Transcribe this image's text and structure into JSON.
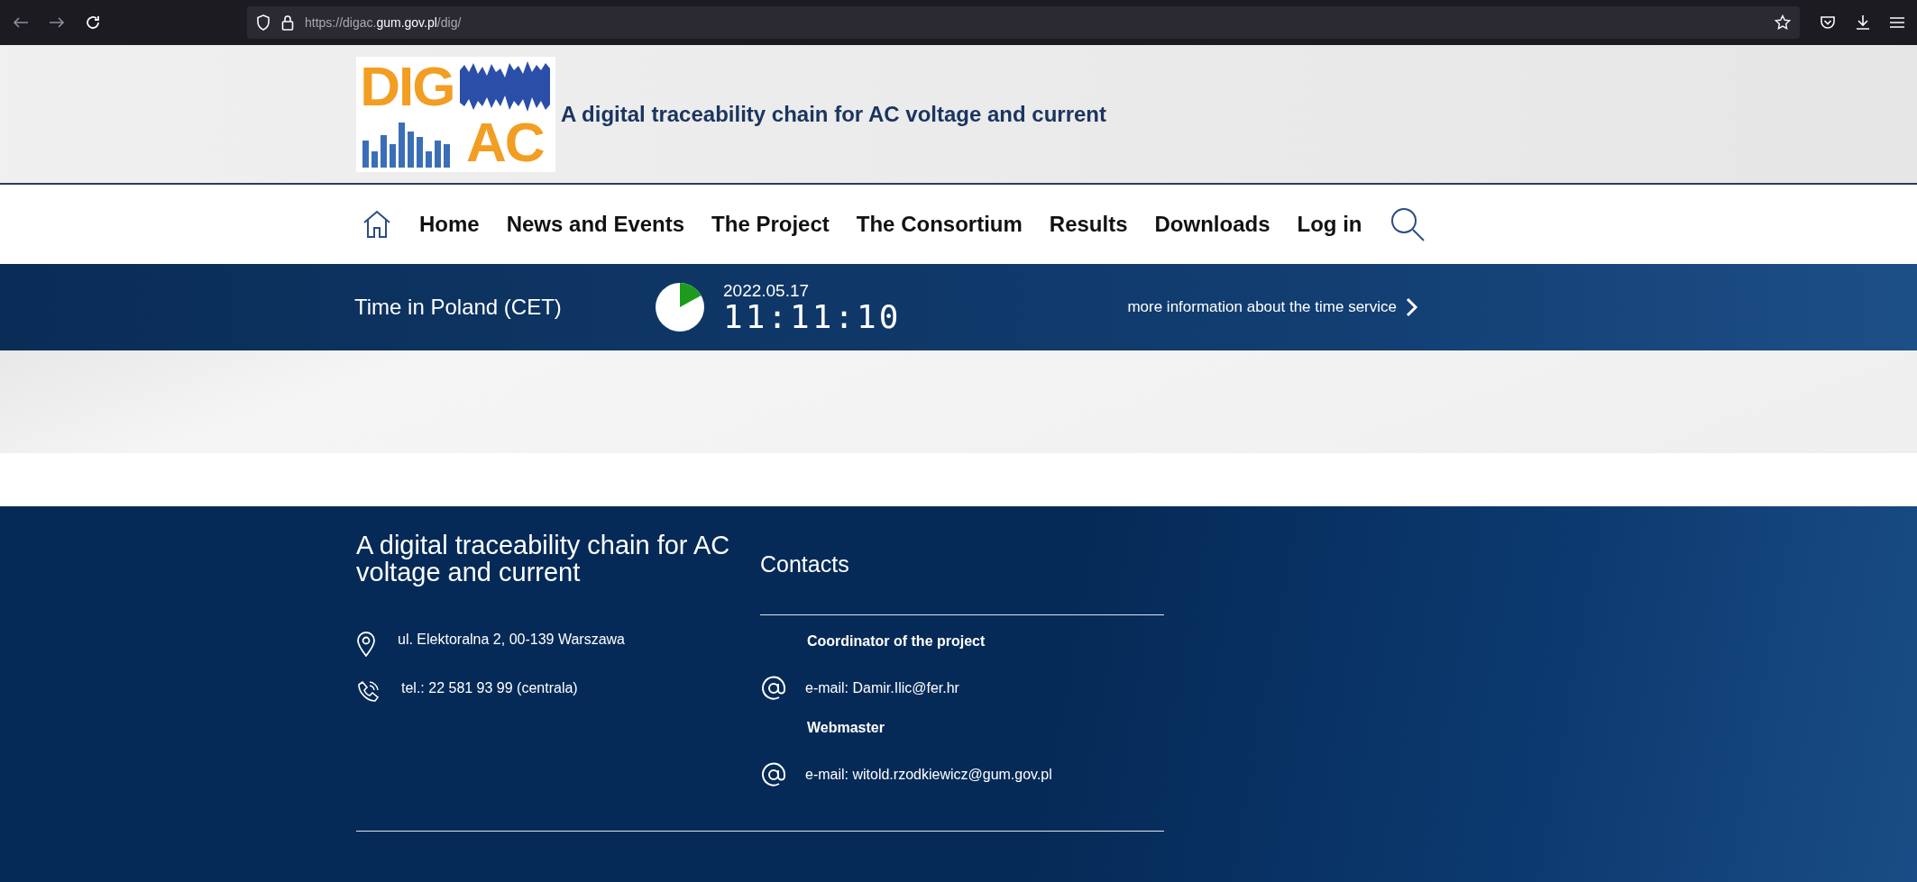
{
  "browser": {
    "url": "https://digac.**gum.gov.pl**/dig/"
  },
  "header": {
    "logo_top": "DIG",
    "logo_bottom": "AC",
    "title": "A digital traceability chain for AC voltage and current"
  },
  "nav": {
    "items": [
      {
        "label": "Home"
      },
      {
        "label": "News and Events"
      },
      {
        "label": "The Project"
      },
      {
        "label": "The Consortium"
      },
      {
        "label": "Results"
      },
      {
        "label": "Downloads"
      },
      {
        "label": "Log in"
      }
    ]
  },
  "time_bar": {
    "label": "Time in Poland (CET)",
    "date": "2022.05.17",
    "time": "11:11:10",
    "link": "more information about the time service"
  },
  "footer": {
    "title": "A digital traceability chain for AC voltage and current",
    "address": "ul. Elektoralna 2, 00-139 Warszawa",
    "phone": "tel.: 22 581 93 99 (centrala)",
    "contacts_title": "Contacts",
    "contacts": [
      {
        "role": "Coordinator of the project",
        "email": "e-mail: Damir.Ilic@fer.hr"
      },
      {
        "role": "Webmaster",
        "email": "e-mail: witold.rzodkiewicz@gum.gov.pl"
      }
    ]
  }
}
